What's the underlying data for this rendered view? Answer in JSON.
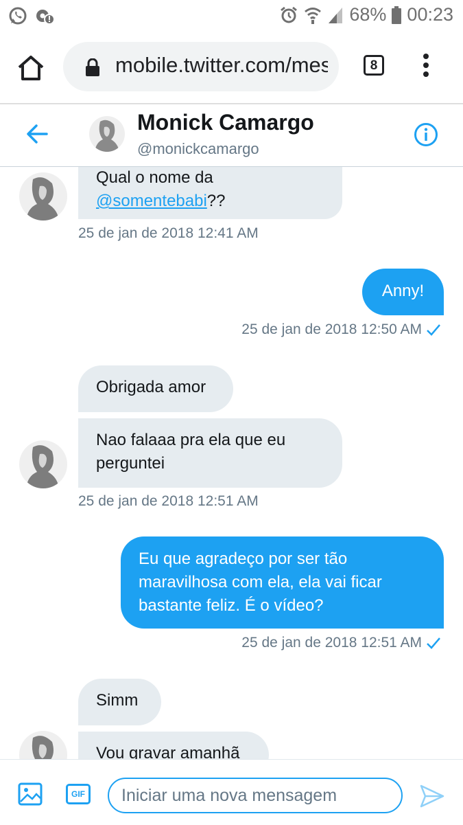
{
  "status_bar": {
    "battery": "68%",
    "time": "00:23"
  },
  "browser": {
    "url": "mobile.twitter.com/messages",
    "tab_count": "8"
  },
  "conversation": {
    "name": "Monick Camargo",
    "handle": "@monickcamargo"
  },
  "messages": [
    {
      "direction": "in",
      "text_before": "Qual o nome da",
      "mention": "@somentebabi",
      "text_after": "??",
      "timestamp": "25 de jan de 2018 12:41 AM"
    },
    {
      "direction": "out",
      "text": "Anny!",
      "timestamp": "25 de jan de 2018 12:50 AM"
    },
    {
      "direction": "in",
      "text": "Obrigada amor"
    },
    {
      "direction": "in",
      "text": "Nao falaaa pra ela que eu perguntei",
      "timestamp": "25 de jan de 2018 12:51 AM"
    },
    {
      "direction": "out",
      "text": "Eu que agradeço por ser tão maravilhosa com ela, ela vai ficar bastante feliz. É o vídeo?",
      "timestamp": "25 de jan de 2018 12:51 AM"
    },
    {
      "direction": "in",
      "text": "Simm"
    },
    {
      "direction": "in",
      "text": "Vou gravar amanhã"
    }
  ],
  "composer": {
    "placeholder": "Iniciar uma nova mensagem",
    "gif_label": "GIF"
  },
  "colors": {
    "accent": "#1da1f2",
    "incoming_bubble": "#e6ecf0",
    "timestamp": "#657786"
  }
}
